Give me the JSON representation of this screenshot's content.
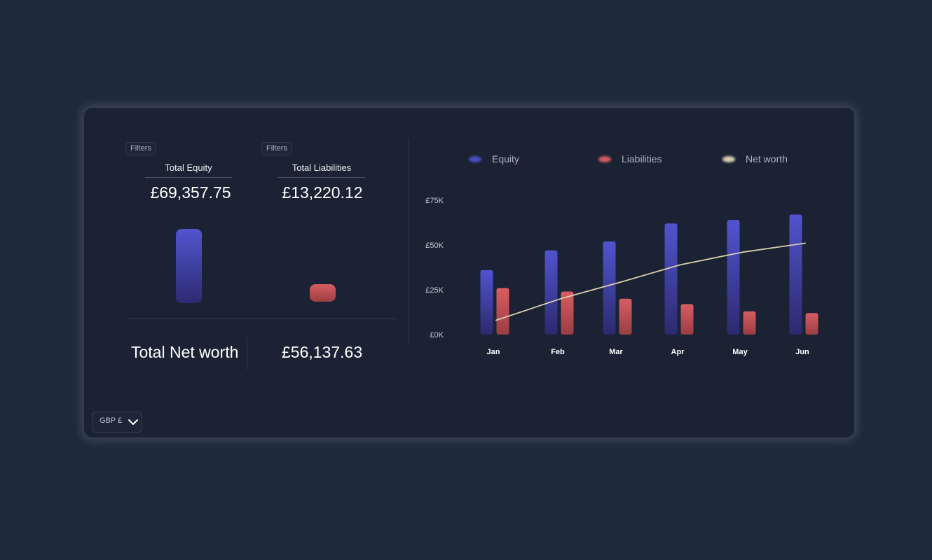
{
  "summary": {
    "equity": {
      "filter_label": "Filters",
      "label": "Total Equity",
      "value": "£69,357.75"
    },
    "liabilities": {
      "filter_label": "Filters",
      "label": "Total Liabilities",
      "value": "£13,220.12"
    },
    "net_worth": {
      "label": "Total Net worth",
      "value": "£56,137.63"
    }
  },
  "currency": {
    "selected": "GBP £"
  },
  "colors": {
    "equity": "#4b4cc4",
    "liabilities": "#d35c60",
    "net_worth": "#d8cfae"
  },
  "chart_data": {
    "type": "bar",
    "categories": [
      "Jan",
      "Feb",
      "Mar",
      "Apr",
      "May",
      "Jun"
    ],
    "series": [
      {
        "name": "Equity",
        "type": "bar",
        "values": [
          36000,
          47000,
          52000,
          62000,
          64000,
          67000
        ]
      },
      {
        "name": "Liabilities",
        "type": "bar",
        "values": [
          26000,
          24000,
          20000,
          17000,
          13000,
          12000
        ]
      },
      {
        "name": "Net worth",
        "type": "line",
        "values": [
          8000,
          20000,
          29000,
          39000,
          46000,
          51000
        ]
      }
    ],
    "y_ticks": [
      "£0K",
      "£25K",
      "£50K",
      "£75K"
    ],
    "ylim": [
      0,
      75000
    ],
    "legend_position": "top",
    "grid": false
  }
}
